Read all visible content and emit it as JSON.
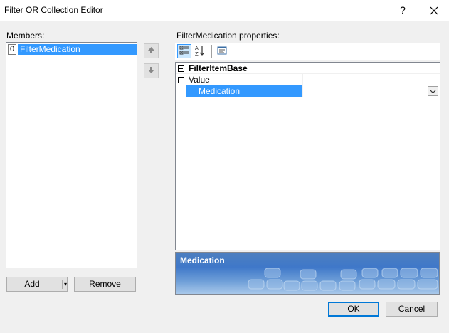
{
  "window": {
    "title": "Filter OR Collection Editor",
    "help_glyph": "?",
    "close_icon": "close-icon"
  },
  "members": {
    "label": "Members:",
    "items": [
      {
        "index": "0",
        "name": "FilterMedication",
        "selected": true
      }
    ],
    "move_up_icon": "arrow-up-icon",
    "move_down_icon": "arrow-down-icon",
    "add_label": "Add",
    "add_dropdown_glyph": "▾",
    "remove_label": "Remove"
  },
  "properties": {
    "label": "FilterMedication properties:",
    "toolbar": {
      "categorized_icon": "categorized-icon",
      "alphabetical_icon": "alphabetical-sort-icon",
      "property_pages_icon": "property-pages-icon"
    },
    "category": "FilterItemBase",
    "group": "Value",
    "selected_property": "Medication",
    "selected_value": ""
  },
  "description": {
    "title": "Medication"
  },
  "footer": {
    "ok_label": "OK",
    "cancel_label": "Cancel"
  },
  "colors": {
    "selection": "#3399ff",
    "default_button_border": "#0078d7",
    "description_bg": "#3f78c9"
  }
}
